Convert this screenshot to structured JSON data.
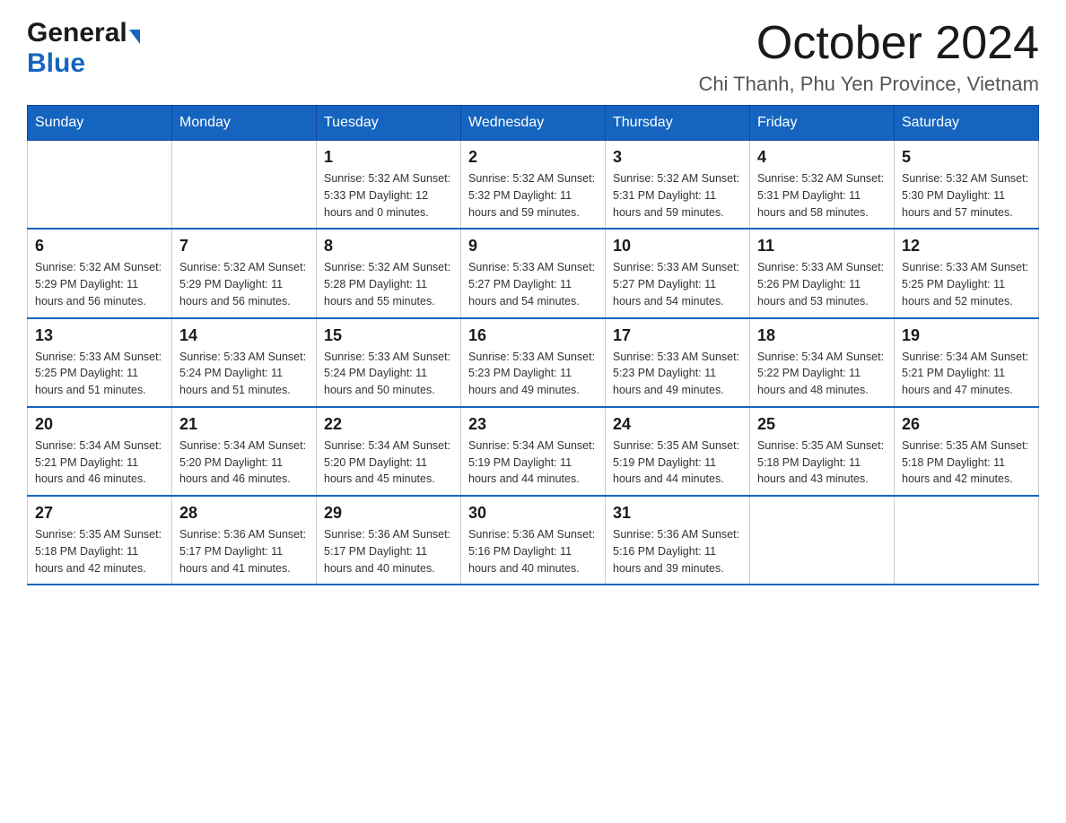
{
  "header": {
    "logo_general": "General",
    "logo_blue": "Blue",
    "main_title": "October 2024",
    "subtitle": "Chi Thanh, Phu Yen Province, Vietnam"
  },
  "calendar": {
    "days_of_week": [
      "Sunday",
      "Monday",
      "Tuesday",
      "Wednesday",
      "Thursday",
      "Friday",
      "Saturday"
    ],
    "weeks": [
      [
        {
          "day": "",
          "info": ""
        },
        {
          "day": "",
          "info": ""
        },
        {
          "day": "1",
          "info": "Sunrise: 5:32 AM\nSunset: 5:33 PM\nDaylight: 12 hours\nand 0 minutes."
        },
        {
          "day": "2",
          "info": "Sunrise: 5:32 AM\nSunset: 5:32 PM\nDaylight: 11 hours\nand 59 minutes."
        },
        {
          "day": "3",
          "info": "Sunrise: 5:32 AM\nSunset: 5:31 PM\nDaylight: 11 hours\nand 59 minutes."
        },
        {
          "day": "4",
          "info": "Sunrise: 5:32 AM\nSunset: 5:31 PM\nDaylight: 11 hours\nand 58 minutes."
        },
        {
          "day": "5",
          "info": "Sunrise: 5:32 AM\nSunset: 5:30 PM\nDaylight: 11 hours\nand 57 minutes."
        }
      ],
      [
        {
          "day": "6",
          "info": "Sunrise: 5:32 AM\nSunset: 5:29 PM\nDaylight: 11 hours\nand 56 minutes."
        },
        {
          "day": "7",
          "info": "Sunrise: 5:32 AM\nSunset: 5:29 PM\nDaylight: 11 hours\nand 56 minutes."
        },
        {
          "day": "8",
          "info": "Sunrise: 5:32 AM\nSunset: 5:28 PM\nDaylight: 11 hours\nand 55 minutes."
        },
        {
          "day": "9",
          "info": "Sunrise: 5:33 AM\nSunset: 5:27 PM\nDaylight: 11 hours\nand 54 minutes."
        },
        {
          "day": "10",
          "info": "Sunrise: 5:33 AM\nSunset: 5:27 PM\nDaylight: 11 hours\nand 54 minutes."
        },
        {
          "day": "11",
          "info": "Sunrise: 5:33 AM\nSunset: 5:26 PM\nDaylight: 11 hours\nand 53 minutes."
        },
        {
          "day": "12",
          "info": "Sunrise: 5:33 AM\nSunset: 5:25 PM\nDaylight: 11 hours\nand 52 minutes."
        }
      ],
      [
        {
          "day": "13",
          "info": "Sunrise: 5:33 AM\nSunset: 5:25 PM\nDaylight: 11 hours\nand 51 minutes."
        },
        {
          "day": "14",
          "info": "Sunrise: 5:33 AM\nSunset: 5:24 PM\nDaylight: 11 hours\nand 51 minutes."
        },
        {
          "day": "15",
          "info": "Sunrise: 5:33 AM\nSunset: 5:24 PM\nDaylight: 11 hours\nand 50 minutes."
        },
        {
          "day": "16",
          "info": "Sunrise: 5:33 AM\nSunset: 5:23 PM\nDaylight: 11 hours\nand 49 minutes."
        },
        {
          "day": "17",
          "info": "Sunrise: 5:33 AM\nSunset: 5:23 PM\nDaylight: 11 hours\nand 49 minutes."
        },
        {
          "day": "18",
          "info": "Sunrise: 5:34 AM\nSunset: 5:22 PM\nDaylight: 11 hours\nand 48 minutes."
        },
        {
          "day": "19",
          "info": "Sunrise: 5:34 AM\nSunset: 5:21 PM\nDaylight: 11 hours\nand 47 minutes."
        }
      ],
      [
        {
          "day": "20",
          "info": "Sunrise: 5:34 AM\nSunset: 5:21 PM\nDaylight: 11 hours\nand 46 minutes."
        },
        {
          "day": "21",
          "info": "Sunrise: 5:34 AM\nSunset: 5:20 PM\nDaylight: 11 hours\nand 46 minutes."
        },
        {
          "day": "22",
          "info": "Sunrise: 5:34 AM\nSunset: 5:20 PM\nDaylight: 11 hours\nand 45 minutes."
        },
        {
          "day": "23",
          "info": "Sunrise: 5:34 AM\nSunset: 5:19 PM\nDaylight: 11 hours\nand 44 minutes."
        },
        {
          "day": "24",
          "info": "Sunrise: 5:35 AM\nSunset: 5:19 PM\nDaylight: 11 hours\nand 44 minutes."
        },
        {
          "day": "25",
          "info": "Sunrise: 5:35 AM\nSunset: 5:18 PM\nDaylight: 11 hours\nand 43 minutes."
        },
        {
          "day": "26",
          "info": "Sunrise: 5:35 AM\nSunset: 5:18 PM\nDaylight: 11 hours\nand 42 minutes."
        }
      ],
      [
        {
          "day": "27",
          "info": "Sunrise: 5:35 AM\nSunset: 5:18 PM\nDaylight: 11 hours\nand 42 minutes."
        },
        {
          "day": "28",
          "info": "Sunrise: 5:36 AM\nSunset: 5:17 PM\nDaylight: 11 hours\nand 41 minutes."
        },
        {
          "day": "29",
          "info": "Sunrise: 5:36 AM\nSunset: 5:17 PM\nDaylight: 11 hours\nand 40 minutes."
        },
        {
          "day": "30",
          "info": "Sunrise: 5:36 AM\nSunset: 5:16 PM\nDaylight: 11 hours\nand 40 minutes."
        },
        {
          "day": "31",
          "info": "Sunrise: 5:36 AM\nSunset: 5:16 PM\nDaylight: 11 hours\nand 39 minutes."
        },
        {
          "day": "",
          "info": ""
        },
        {
          "day": "",
          "info": ""
        }
      ]
    ]
  }
}
